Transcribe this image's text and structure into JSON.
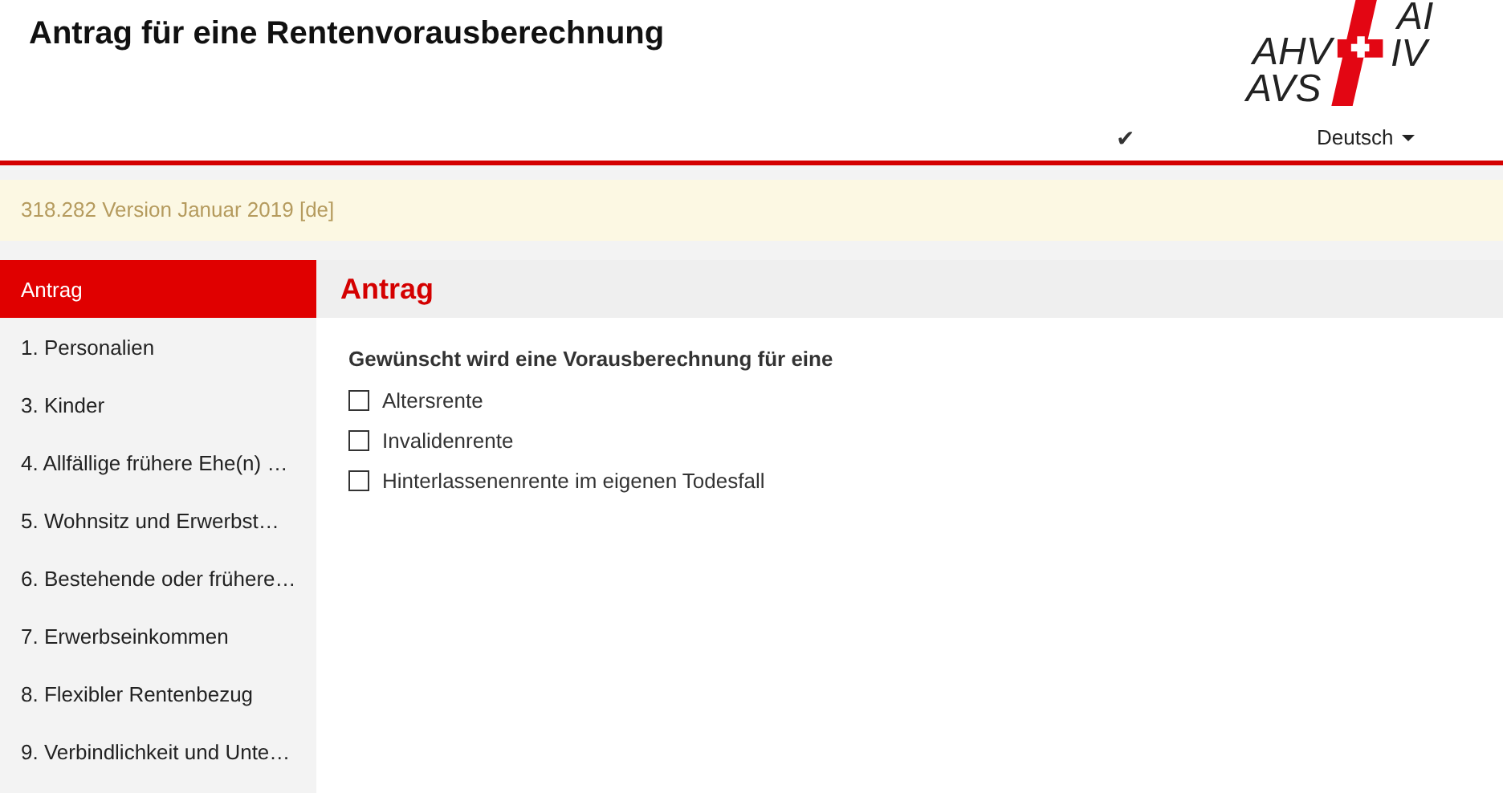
{
  "header": {
    "title": "Antrag für eine Rentenvorausberechnung",
    "logo": {
      "left_top": "AHV",
      "left_bottom": "AVS",
      "right_top": "AI",
      "right_bottom": "IV"
    },
    "check_mark": "✔",
    "language": "Deutsch"
  },
  "banner": "318.282 Version Januar 2019 [de]",
  "sidebar": {
    "items": [
      {
        "label": "Antrag",
        "selected": true
      },
      {
        "label": "1. Personalien",
        "selected": false
      },
      {
        "label": "3. Kinder",
        "selected": false
      },
      {
        "label": "4. Allfällige frühere Ehe(n) …",
        "selected": false
      },
      {
        "label": "5. Wohnsitz und Erwerbst…",
        "selected": false
      },
      {
        "label": "6. Bestehende oder frühere…",
        "selected": false
      },
      {
        "label": "7. Erwerbseinkommen",
        "selected": false
      },
      {
        "label": "8. Flexibler Rentenbezug",
        "selected": false
      },
      {
        "label": "9. Verbindlichkeit und Unte…",
        "selected": false
      }
    ]
  },
  "main": {
    "heading": "Antrag",
    "question": "Gewünscht wird eine Vorausberechnung für eine",
    "options": [
      {
        "label": "Altersrente",
        "checked": false
      },
      {
        "label": "Invalidenrente",
        "checked": false
      },
      {
        "label": "Hinterlassenenrente im eigenen Todesfall",
        "checked": false
      }
    ]
  }
}
